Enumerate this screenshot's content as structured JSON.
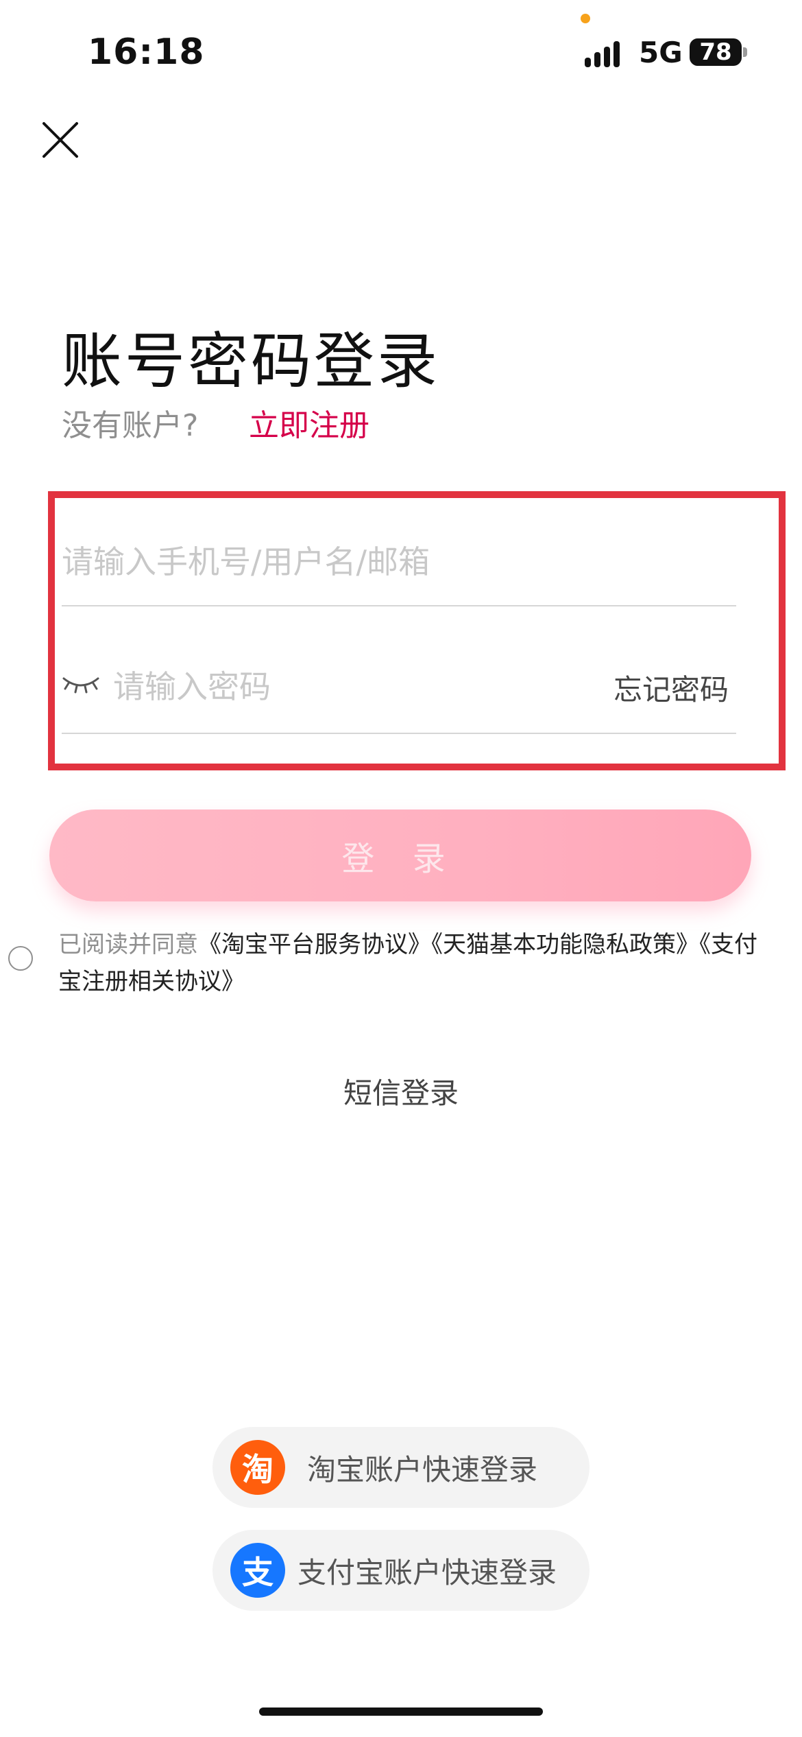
{
  "status_bar": {
    "time": "16:18",
    "network": "5G",
    "battery": "78"
  },
  "page": {
    "title": "账号密码登录",
    "no_account_text": "没有账户?",
    "register_link": "立即注册"
  },
  "form": {
    "account_placeholder": "请输入手机号/用户名/邮箱",
    "password_placeholder": "请输入密码",
    "forgot_password": "忘记密码",
    "login_button": "登 录",
    "highlight_color": "#e2333f"
  },
  "agreement": {
    "prefix": "已阅读并同意",
    "links_line": "《淘宝平台服务协议》《天猫基本功能隐私政策》《支付宝注册相关协议》"
  },
  "sms_login": "短信登录",
  "quick_login": {
    "taobao": {
      "icon_text": "淘",
      "label": "淘宝账户快速登录",
      "color": "#ff5e0d"
    },
    "alipay": {
      "icon_text": "支",
      "label": "支付宝账户快速登录",
      "color": "#1677ff"
    }
  },
  "colors": {
    "accent": "#d5004a",
    "login_button": "#ffb0c0"
  }
}
